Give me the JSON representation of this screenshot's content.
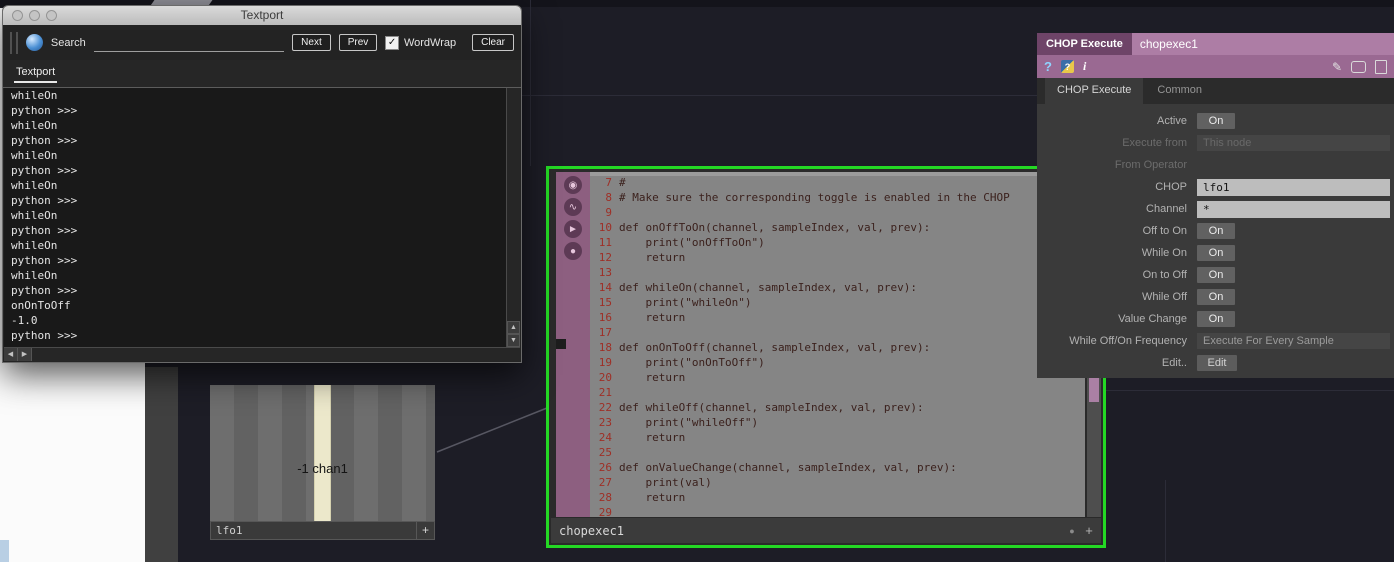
{
  "textport": {
    "title": "Textport",
    "search_label": "Search",
    "next": "Next",
    "prev": "Prev",
    "wordwrap": "WordWrap",
    "clear": "Clear",
    "tab": "Textport",
    "console_lines": [
      "whileOn",
      "python >>>",
      "whileOn",
      "python >>>",
      "whileOn",
      "python >>>",
      "whileOn",
      "python >>>",
      "whileOn",
      "python >>>",
      "whileOn",
      "python >>>",
      "whileOn",
      "python >>>",
      "onOnToOff",
      "-1.0",
      "python >>>"
    ]
  },
  "lfo": {
    "value_label": "-1 chan1",
    "name": "lfo1"
  },
  "chopexec": {
    "name": "chopexec1",
    "flags": [
      {
        "glyph": "◉"
      },
      {
        "glyph": "∿"
      },
      {
        "glyph": "►"
      },
      {
        "glyph": "●"
      }
    ],
    "code": [
      {
        "n": "7",
        "t": "#"
      },
      {
        "n": "8",
        "t": "# Make sure the corresponding toggle is enabled in the CHOP"
      },
      {
        "n": "9",
        "t": ""
      },
      {
        "n": "10",
        "t": "def onOffToOn(channel, sampleIndex, val, prev):"
      },
      {
        "n": "11",
        "t": "    print(\"onOffToOn\")"
      },
      {
        "n": "12",
        "t": "    return"
      },
      {
        "n": "13",
        "t": ""
      },
      {
        "n": "14",
        "t": "def whileOn(channel, sampleIndex, val, prev):"
      },
      {
        "n": "15",
        "t": "    print(\"whileOn\")"
      },
      {
        "n": "16",
        "t": "    return"
      },
      {
        "n": "17",
        "t": ""
      },
      {
        "n": "18",
        "t": "def onOnToOff(channel, sampleIndex, val, prev):"
      },
      {
        "n": "19",
        "t": "    print(\"onOnToOff\")"
      },
      {
        "n": "20",
        "t": "    return"
      },
      {
        "n": "21",
        "t": ""
      },
      {
        "n": "22",
        "t": "def whileOff(channel, sampleIndex, val, prev):"
      },
      {
        "n": "23",
        "t": "    print(\"whileOff\")"
      },
      {
        "n": "24",
        "t": "    return"
      },
      {
        "n": "25",
        "t": ""
      },
      {
        "n": "26",
        "t": "def onValueChange(channel, sampleIndex, val, prev):"
      },
      {
        "n": "27",
        "t": "    print(val)"
      },
      {
        "n": "28",
        "t": "    return"
      },
      {
        "n": "29",
        "t": ""
      }
    ]
  },
  "panel": {
    "type_label": "CHOP Execute",
    "node_name": "chopexec1",
    "tabs": [
      {
        "label": "CHOP Execute",
        "cls": "active"
      },
      {
        "label": "Common",
        "cls": ""
      }
    ],
    "rows": [
      {
        "label": "Active",
        "value": "On",
        "type": "toggle"
      },
      {
        "label": "Execute from",
        "value": "This node",
        "type": "menu_dim"
      },
      {
        "label": "From Operator",
        "value": "",
        "type": "empty_dim"
      },
      {
        "label": "CHOP",
        "value": "lfo1",
        "type": "field"
      },
      {
        "label": "Channel",
        "value": "*",
        "type": "field"
      },
      {
        "label": "Off to On",
        "value": "On",
        "type": "toggle"
      },
      {
        "label": "While On",
        "value": "On",
        "type": "toggle"
      },
      {
        "label": "On to Off",
        "value": "On",
        "type": "toggle"
      },
      {
        "label": "While Off",
        "value": "On",
        "type": "toggle"
      },
      {
        "label": "Value Change",
        "value": "On",
        "type": "toggle"
      },
      {
        "label": "While Off/On Frequency",
        "value": "Execute For Every Sample",
        "type": "menu"
      },
      {
        "label": "Edit..",
        "value": "Edit",
        "type": "button"
      }
    ]
  },
  "icons": {
    "help": "?",
    "python_help": "?",
    "info": "i",
    "pencil": "✎",
    "check": "✓",
    "plus": "+",
    "dot": "●",
    "up": "▲",
    "down": "▼",
    "left": "◀",
    "right": "▶"
  }
}
